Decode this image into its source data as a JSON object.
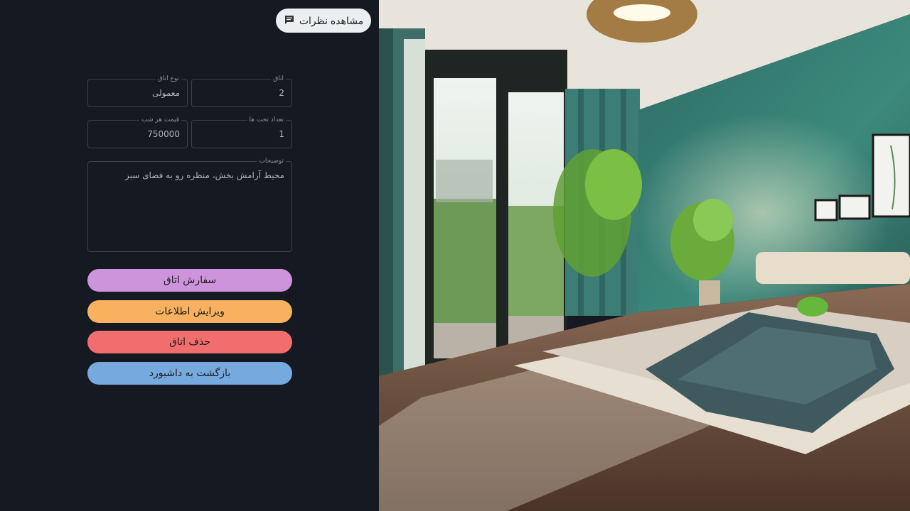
{
  "header": {
    "reviews_label": "مشاهده نظرات"
  },
  "form": {
    "room": {
      "label": "اتاق",
      "value": "2"
    },
    "room_type": {
      "label": "نوع اتاق",
      "value": "معمولی"
    },
    "bed_count": {
      "label": "تعداد تخت ها",
      "value": "1"
    },
    "price_per_night": {
      "label": "قیمت هر شب",
      "value": "750000"
    },
    "description": {
      "label": "توضیحات",
      "value": "محیط آرامش بخش، منظره رو به فضای سبز"
    }
  },
  "actions": {
    "order": {
      "label": "سفارش اتاق",
      "color": "#cd94dc"
    },
    "edit": {
      "label": "ویرایش اطلاعات",
      "color": "#f7b15f"
    },
    "delete": {
      "label": "حذف اتاق",
      "color": "#f26e6e"
    },
    "back": {
      "label": "بازگشت به داشبورد",
      "color": "#76aadf"
    }
  }
}
